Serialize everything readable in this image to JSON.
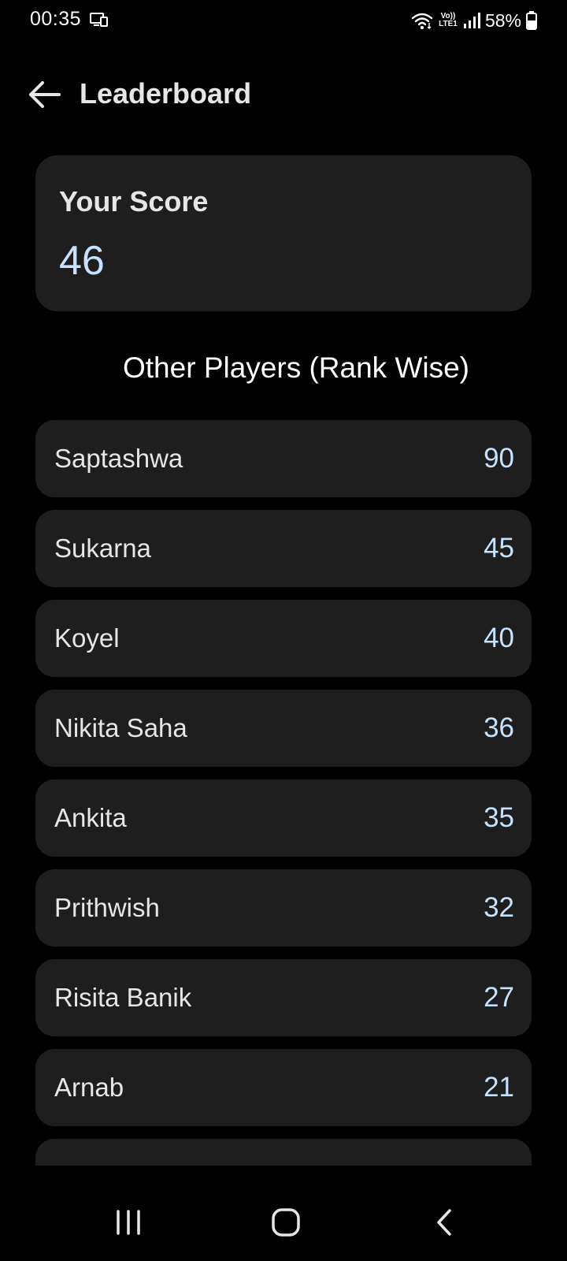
{
  "status_bar": {
    "time": "00:35",
    "volte_top": "Vo))",
    "volte_bottom": "LTE1",
    "battery": "58%"
  },
  "app_bar": {
    "title": "Leaderboard",
    "back_icon": "arrow-left-icon"
  },
  "score_card": {
    "label": "Your Score",
    "value": "46"
  },
  "section_title": "Other Players (Rank Wise)",
  "players": [
    {
      "name": "Saptashwa",
      "score": "90"
    },
    {
      "name": "Sukarna",
      "score": "45"
    },
    {
      "name": "Koyel",
      "score": "40"
    },
    {
      "name": "Nikita Saha",
      "score": "36"
    },
    {
      "name": "Ankita",
      "score": "35"
    },
    {
      "name": "Prithwish",
      "score": "32"
    },
    {
      "name": "Risita Banik",
      "score": "27"
    },
    {
      "name": "Arnab",
      "score": "21"
    }
  ],
  "nav_bar": {
    "recents_icon": "recents-icon",
    "home_icon": "home-icon",
    "back_icon": "chevron-left-icon"
  },
  "colors": {
    "background": "#000000",
    "card": "#1e1e1e",
    "score_accent": "#c6e2ff",
    "text": "#e6e6e6"
  }
}
